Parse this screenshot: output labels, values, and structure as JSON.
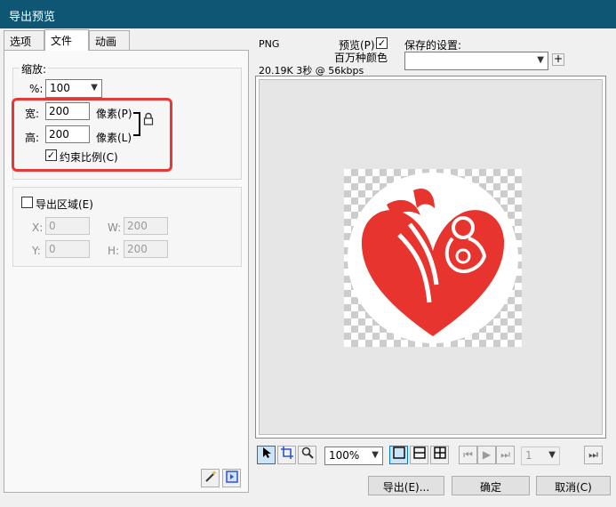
{
  "window": {
    "title": "导出预览"
  },
  "tabs": [
    {
      "label": "选项",
      "active": false
    },
    {
      "label": "文件",
      "active": true
    },
    {
      "label": "动画",
      "active": false
    }
  ],
  "scale": {
    "group_label": "缩放:",
    "percent_label": "%:",
    "percent_value": "100"
  },
  "size": {
    "width_label": "宽:",
    "width_value": "200",
    "width_unit": "像素(P)",
    "height_label": "高:",
    "height_value": "200",
    "height_unit": "像素(L)",
    "constrain_label": "约束比例(C)",
    "constrain_checked": "✓"
  },
  "export_area": {
    "label": "导出区域(E)",
    "checked": "",
    "x_label": "X:",
    "x_value": "0",
    "w_label": "W:",
    "w_value": "200",
    "y_label": "Y:",
    "y_value": "0",
    "h_label": "H:",
    "h_value": "200"
  },
  "preview_info": {
    "format": "PNG",
    "preview_label": "预览(P)",
    "preview_checked": "✓",
    "colors": "百万种颜色",
    "stats": "20.19K  3秒 @ 56kbps"
  },
  "saved_settings": {
    "label": "保存的设置:",
    "value": ""
  },
  "toolbar": {
    "zoom_value": "100%",
    "frame_value": "1"
  },
  "buttons": {
    "export": "导出(E)...",
    "ok": "确定",
    "cancel": "取消(C)"
  },
  "colors": {
    "title_bar": "#0f5675",
    "highlight_box": "#e53935",
    "logo_red": "#e8342e"
  }
}
